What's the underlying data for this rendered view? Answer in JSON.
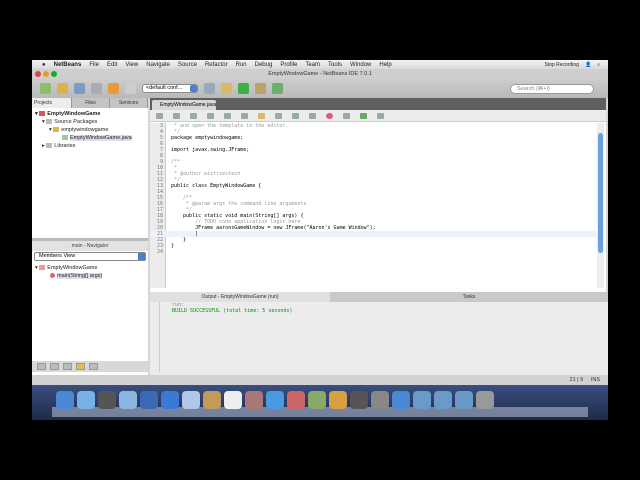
{
  "menubar": {
    "app": "NetBeans",
    "items": [
      "File",
      "Edit",
      "View",
      "Navigate",
      "Source",
      "Refactor",
      "Run",
      "Debug",
      "Profile",
      "Team",
      "Tools",
      "Window",
      "Help"
    ],
    "stop_recording": "Stop Recording"
  },
  "window": {
    "title": "EmptyWindowGame - NetBeans IDE 7.0.1"
  },
  "toolbar": {
    "config": "<default conf...",
    "search_placeholder": "Search (⌘+I)"
  },
  "projects": {
    "tabs": [
      "Projects",
      "Files",
      "Services"
    ],
    "tree": [
      "EmptyWindowGame",
      "Source Packages",
      "emptywindowgame",
      "EmptyWindowGame.java",
      "Libraries"
    ]
  },
  "navigator": {
    "title": "main - Navigator",
    "view": "Members View",
    "tree": [
      "EmptyWindowGame",
      "main(String[] args)"
    ]
  },
  "editor": {
    "tab": "EmptyWindowGame.java",
    "lines": [
      {
        "n": "3",
        "t": " * and open the template in the editor.",
        "c": "cm"
      },
      {
        "n": "4",
        "t": " */",
        "c": "cm"
      },
      {
        "n": "5",
        "t": "package emptywindowgame;",
        "c": ""
      },
      {
        "n": "6",
        "t": "",
        "c": ""
      },
      {
        "n": "7",
        "t": "import javax.swing.JFrame;",
        "c": ""
      },
      {
        "n": "8",
        "t": "",
        "c": ""
      },
      {
        "n": "9",
        "t": "/**",
        "c": "cm"
      },
      {
        "n": "10",
        "t": " *",
        "c": "cm"
      },
      {
        "n": "11",
        "t": " * @author wiztriestech",
        "c": "cm"
      },
      {
        "n": "12",
        "t": " */",
        "c": "cm"
      },
      {
        "n": "13",
        "t": "public class EmptyWindowGame {",
        "c": ""
      },
      {
        "n": "14",
        "t": "",
        "c": ""
      },
      {
        "n": "15",
        "t": "    /**",
        "c": "cm"
      },
      {
        "n": "16",
        "t": "     * @param args the command line arguments",
        "c": "cm"
      },
      {
        "n": "17",
        "t": "     */",
        "c": "cm"
      },
      {
        "n": "18",
        "t": "    public static void main(String[] args) {",
        "c": ""
      },
      {
        "n": "19",
        "t": "        // TODO code application logic here",
        "c": "cm"
      },
      {
        "n": "20",
        "t": "        JFrame aaronsGameWindow = new JFrame(\"Aaron's Game Window\");",
        "c": ""
      },
      {
        "n": "21",
        "t": "        |",
        "c": ""
      },
      {
        "n": "22",
        "t": "    }",
        "c": ""
      },
      {
        "n": "23",
        "t": "}",
        "c": ""
      },
      {
        "n": "24",
        "t": "",
        "c": ""
      }
    ]
  },
  "output": {
    "title": "Output - EmptyWindowGame (run)",
    "tasks": "Tasks",
    "lines": [
      "run:",
      "BUILD SUCCESSFUL (total time: 5 seconds)"
    ]
  },
  "status": {
    "position": "21 | 9",
    "mode": "INS"
  },
  "colors": {
    "accent": "#4a7fd4",
    "success": "#0a8a0a"
  }
}
